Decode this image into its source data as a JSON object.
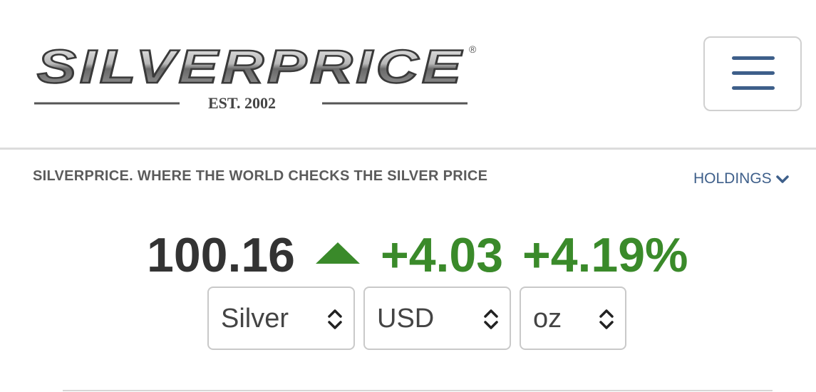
{
  "header": {
    "logo_text": "SILVERPRICE",
    "logo_subtext": "EST. 2002",
    "menu_icon": "hamburger-menu-icon"
  },
  "tagline": "SILVERPRICE. WHERE THE WORLD CHECKS THE SILVER PRICE",
  "holdings": {
    "label": "HOLDINGS",
    "icon": "chevron-down-icon"
  },
  "quote": {
    "price": "100.16",
    "direction_icon": "triangle-up-icon",
    "change": "+4.03",
    "change_percent": "+4.19%"
  },
  "selectors": {
    "metal": "Silver",
    "currency": "USD",
    "unit": "oz"
  },
  "colors": {
    "up": "#3a8a2a",
    "price": "#333333",
    "link": "#3e5f8a"
  }
}
